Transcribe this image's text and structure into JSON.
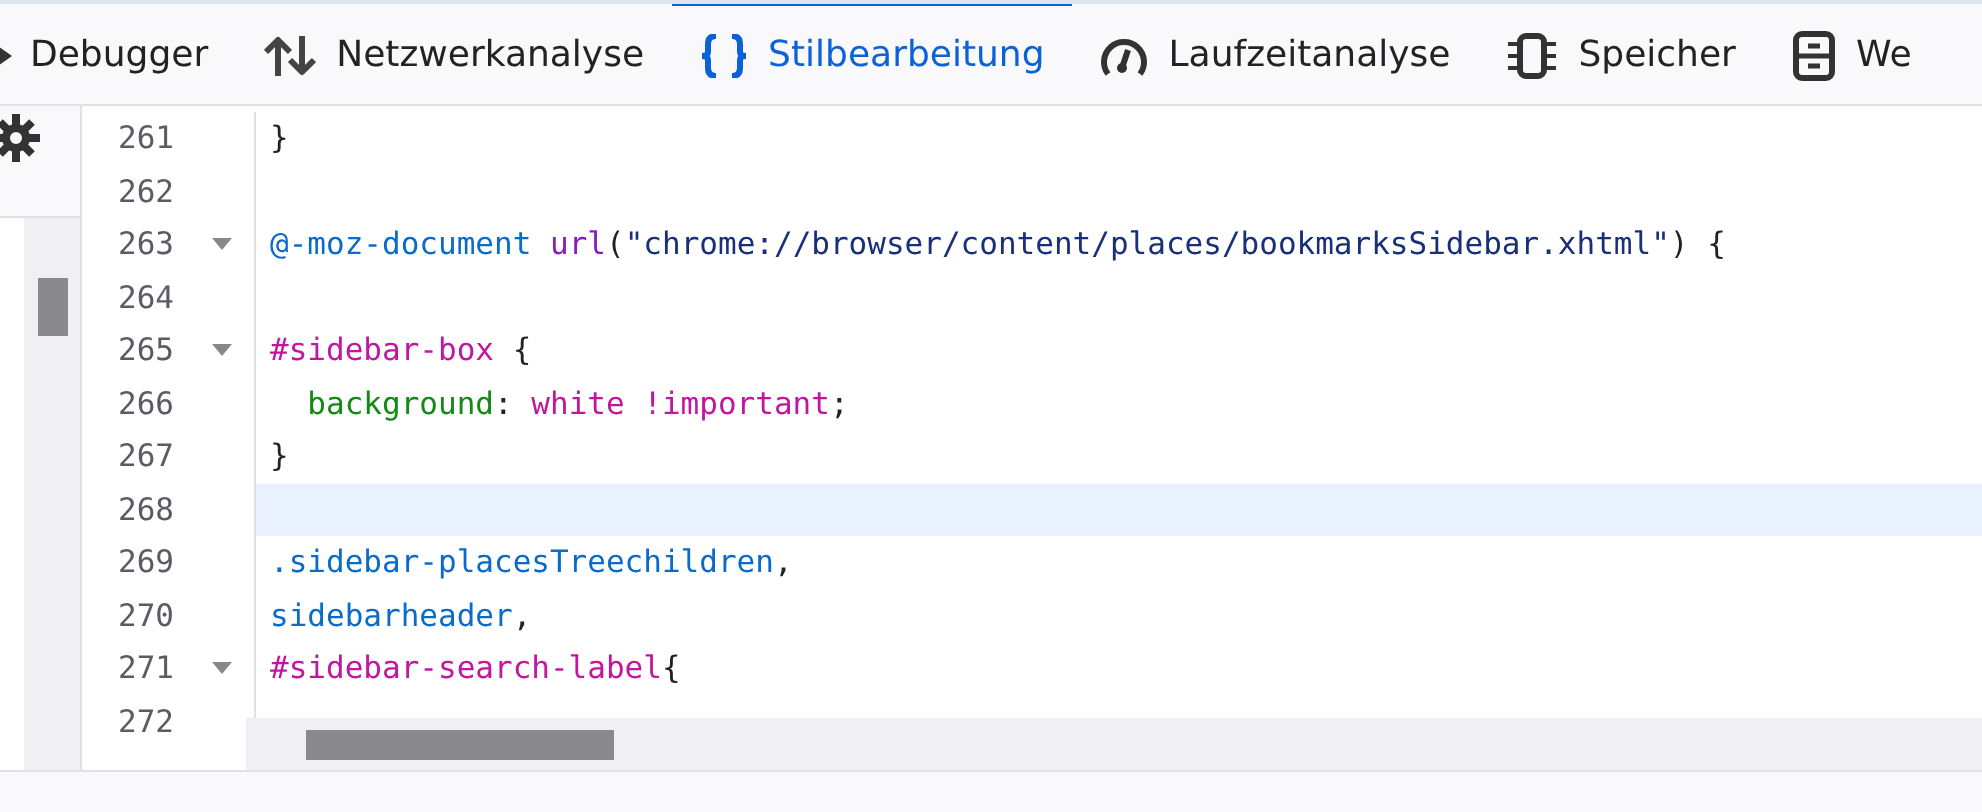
{
  "tabs": [
    {
      "label": "Debugger",
      "kind": "debugger",
      "selected": false
    },
    {
      "label": "Netzwerkanalyse",
      "kind": "network",
      "selected": false
    },
    {
      "label": "Stilbearbeitung",
      "kind": "braces",
      "selected": true
    },
    {
      "label": "Laufzeitanalyse",
      "kind": "gauge",
      "selected": false
    },
    {
      "label": "Speicher",
      "kind": "chip",
      "selected": false
    },
    {
      "label": "We",
      "kind": "storage",
      "selected": false
    }
  ],
  "editor": {
    "lines": [
      {
        "number": "261",
        "foldable": false,
        "highlighted": false,
        "tokens": [
          {
            "kind": "punct",
            "text": "}"
          }
        ]
      },
      {
        "number": "262",
        "foldable": false,
        "highlighted": false
      },
      {
        "number": "263",
        "foldable": true,
        "highlighted": false,
        "tokens": [
          {
            "kind": "atrule",
            "text": "@-moz-document "
          },
          {
            "kind": "func",
            "text": "url"
          },
          {
            "kind": "punct",
            "text": "("
          },
          {
            "kind": "string",
            "text": "\"chrome://browser/content/places/bookmarksSidebar.xhtml\""
          },
          {
            "kind": "punct",
            "text": ") {"
          }
        ]
      },
      {
        "number": "264",
        "foldable": false,
        "highlighted": false
      },
      {
        "number": "265",
        "foldable": true,
        "highlighted": false,
        "tokens": [
          {
            "kind": "selector",
            "text": "#sidebar-box"
          },
          {
            "kind": "punct",
            "text": " {"
          }
        ]
      },
      {
        "number": "266",
        "foldable": false,
        "highlighted": false,
        "tokens": [
          {
            "kind": "property",
            "text": "  background"
          },
          {
            "kind": "punct",
            "text": ": "
          },
          {
            "kind": "value",
            "text": "white !important"
          },
          {
            "kind": "punct",
            "text": ";"
          }
        ]
      },
      {
        "number": "267",
        "foldable": false,
        "highlighted": false,
        "tokens": [
          {
            "kind": "punct",
            "text": "}"
          }
        ]
      },
      {
        "number": "268",
        "foldable": false,
        "highlighted": true
      },
      {
        "number": "269",
        "foldable": false,
        "highlighted": false,
        "tokens": [
          {
            "kind": "atrule",
            "text": ".sidebar-placesTreechildren"
          },
          {
            "kind": "punct",
            "text": ","
          }
        ]
      },
      {
        "number": "270",
        "foldable": false,
        "highlighted": false,
        "tokens": [
          {
            "kind": "atrule",
            "text": "sidebarheader"
          },
          {
            "kind": "punct",
            "text": ","
          }
        ]
      },
      {
        "number": "271",
        "foldable": true,
        "highlighted": false,
        "tokens": [
          {
            "kind": "selector",
            "text": "#sidebar-search-label"
          },
          {
            "kind": "punct",
            "text": "{"
          }
        ]
      },
      {
        "number": "272",
        "foldable": false,
        "highlighted": false
      }
    ]
  }
}
